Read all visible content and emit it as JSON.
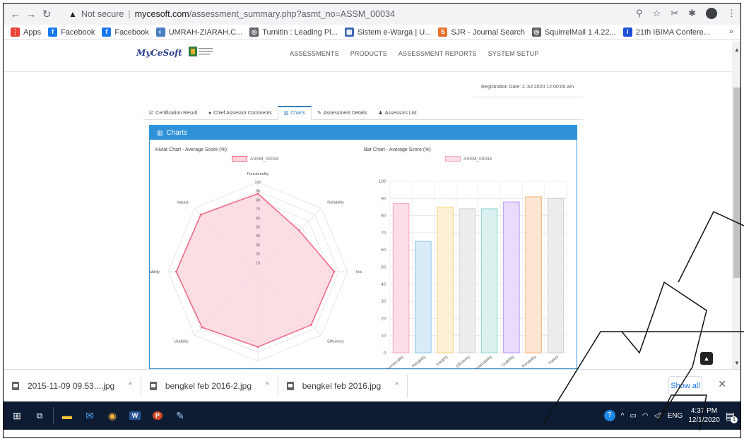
{
  "browser": {
    "security_label": "Not secure",
    "url_host": "mycesoft.com",
    "url_path": "/assessment_summary.php?asmt_no=ASSM_00034"
  },
  "bookmarks": [
    {
      "label": "Apps",
      "color": "#ea4335",
      "glyph": "⋮"
    },
    {
      "label": "Facebook",
      "color": "#1877f2",
      "glyph": "f"
    },
    {
      "label": "Facebook",
      "color": "#1877f2",
      "glyph": "f"
    },
    {
      "label": "UMRAH-ZIARAH.C...",
      "color": "#4a7fc1",
      "glyph": "◐"
    },
    {
      "label": "Turnitin : Leading Pl...",
      "color": "#5f6368",
      "glyph": "◎"
    },
    {
      "label": "Sistem e-Warga | U...",
      "color": "#3b67b5",
      "glyph": "▦"
    },
    {
      "label": "SJR - Journal Search",
      "color": "#e8702a",
      "glyph": "S"
    },
    {
      "label": "SquirrelMail 1.4.22...",
      "color": "#5f6368",
      "glyph": "◎"
    },
    {
      "label": "21th IBIMA Confere...",
      "color": "#1d4ed8",
      "glyph": "I"
    }
  ],
  "site": {
    "logo_text": "MyCeSoft",
    "nav": [
      "ASSESSMENTS",
      "PRODUCTS",
      "ASSESSMENT REPORTS",
      "SYSTEM SETUP"
    ],
    "registration": "Registration Date: 2 Jul 2020 12:00:00 am"
  },
  "tabs": [
    {
      "label": "Certification Result",
      "icon": "☑"
    },
    {
      "label": "Chief Assessor Comments",
      "icon": "●"
    },
    {
      "label": "Charts",
      "icon": "▥"
    },
    {
      "label": "Assessment Details",
      "icon": "✎"
    },
    {
      "label": "Assessors List",
      "icon": "♟"
    }
  ],
  "panel": {
    "title": "Charts"
  },
  "colors": {
    "accent": "#2f92d9",
    "radar_line": "#f06b8a",
    "radar_fill": "#fbd3dc"
  },
  "chart_data": [
    {
      "type": "radar",
      "title": "Kiviat Chart - Average Score (%)",
      "legend": "ASSM_00034",
      "categories": [
        "Functionality",
        "Reliability",
        "Integrity",
        "Efficiency",
        "Maintainability",
        "Usability",
        "Portability",
        "Impact"
      ],
      "values": [
        87,
        65,
        85,
        84,
        84,
        88,
        91,
        90
      ],
      "rlim": [
        0,
        100
      ],
      "ticks": [
        10,
        20,
        30,
        40,
        50,
        60,
        70,
        80,
        90,
        100
      ]
    },
    {
      "type": "bar",
      "title": "Bar Chart - Average Score (%)",
      "legend": "ASSM_00034",
      "categories": [
        "Functionality",
        "Reliability",
        "Integrity",
        "Efficiency",
        "Maintainability",
        "Usability",
        "Portability",
        "Impact"
      ],
      "values": [
        87,
        65,
        85,
        84,
        84,
        88,
        91,
        90
      ],
      "ylim": [
        0,
        100
      ],
      "yticks": [
        0,
        10,
        20,
        30,
        40,
        50,
        60,
        70,
        80,
        90,
        100
      ],
      "bar_fill": [
        "#fcdfe6",
        "#d8ebf8",
        "#fdf1d5",
        "#ececee",
        "#daf1ef",
        "#e8dcfa",
        "#fde6d3",
        "#ececec"
      ],
      "bar_stroke": [
        "#f3a6b8",
        "#8cc3ea",
        "#f7d27e",
        "#cfcfd4",
        "#8fd6cf",
        "#b89af0",
        "#f7b37c",
        "#cdcdcd"
      ]
    }
  ],
  "downloads": {
    "files": [
      "2015-11-09 09.53....jpg",
      "bengkel feb 2016-2.jpg",
      "bengkel feb 2016.jpg"
    ],
    "show_all": "Show all"
  },
  "taskbar": {
    "lang": "ENG",
    "time": "4:37 PM",
    "date": "12/1/2020",
    "notification_count": "1"
  }
}
